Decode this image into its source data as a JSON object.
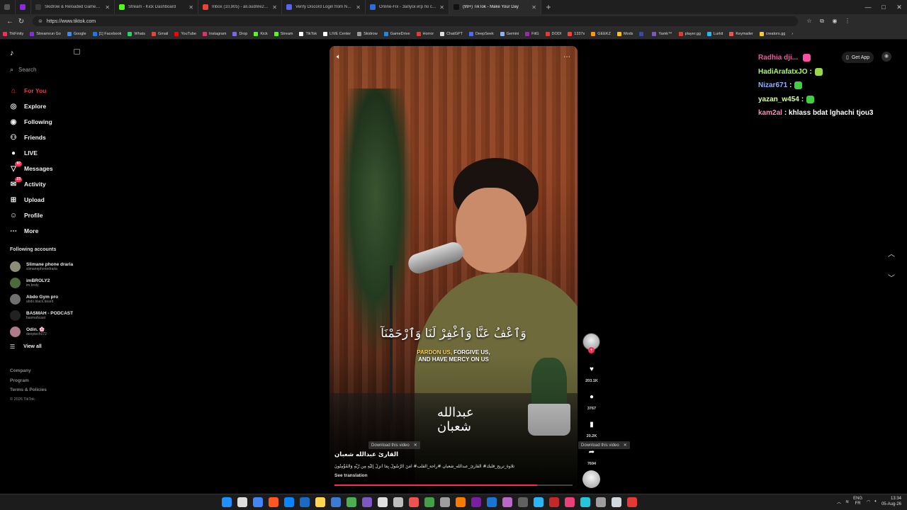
{
  "browser": {
    "tabs": [
      {
        "label": "",
        "color": "#555555"
      },
      {
        "label": "",
        "color": "#8a2be2"
      },
      {
        "label": "Skidrow & Reloaded Games – Do",
        "color": "#3a3a3a"
      },
      {
        "label": "Stream - Kick Dashboard",
        "color": "#53fc18"
      },
      {
        "label": "Inbox (10,905) - ali.oudrire263@",
        "color": "#ea4335"
      },
      {
        "label": "Verify Discord Login from New Lo",
        "color": "#5865f2"
      },
      {
        "label": "Online-Fix - Запуск игр по сети",
        "color": "#2d6cdf"
      },
      {
        "label": "(99+) TikTok - Make Your Day",
        "color": "#111111"
      }
    ],
    "url": "https://www.tiktok.com",
    "window_controls": [
      "—",
      "□",
      "✕"
    ],
    "bookmarks": [
      {
        "label": "TikFinity",
        "color": "#fe2c55"
      },
      {
        "label": "Streamrun Go",
        "color": "#8a2be2"
      },
      {
        "label": "Google",
        "color": "#4285f4"
      },
      {
        "label": "[1] Facebook",
        "color": "#1877f2"
      },
      {
        "label": "Whats",
        "color": "#25d366"
      },
      {
        "label": "Gmail",
        "color": "#ea4335"
      },
      {
        "label": "YouTube",
        "color": "#ff0000"
      },
      {
        "label": "Instagram",
        "color": "#e1306c"
      },
      {
        "label": "Drop",
        "color": "#7b68ee"
      },
      {
        "label": "Kick",
        "color": "#53fc18"
      },
      {
        "label": "Stream",
        "color": "#53fc18"
      },
      {
        "label": "TikTok",
        "color": "#ffffff"
      },
      {
        "label": "LIVE Center",
        "color": "#ffffff"
      },
      {
        "label": "Skidrow",
        "color": "#999999"
      },
      {
        "label": "GameDrive",
        "color": "#1e88e5"
      },
      {
        "label": "Horror",
        "color": "#e53935"
      },
      {
        "label": "ChatGPT",
        "color": "#dddddd"
      },
      {
        "label": "DeepSeek",
        "color": "#4d6bfe"
      },
      {
        "label": "Gemini",
        "color": "#8ab4f8"
      },
      {
        "label": "FitG",
        "color": "#9c27b0"
      },
      {
        "label": "DODI",
        "color": "#e53935"
      },
      {
        "label": "1337x",
        "color": "#f44336"
      },
      {
        "label": "GEEKZ",
        "color": "#ff9800"
      },
      {
        "label": "Mods",
        "color": "#ffc107"
      },
      {
        "label": "",
        "color": "#3949ab"
      },
      {
        "label": "Yamk™",
        "color": "#7e57c2"
      },
      {
        "label": "player.gg",
        "color": "#e53935"
      },
      {
        "label": "Lurkit",
        "color": "#29b6f6"
      },
      {
        "label": "Keymailer",
        "color": "#ef5350"
      },
      {
        "label": "creators.gg",
        "color": "#ffca28"
      }
    ]
  },
  "sidebar": {
    "search_placeholder": "Search",
    "nav": [
      {
        "label": "For You",
        "icon": "home-icon",
        "active": true
      },
      {
        "label": "Explore",
        "icon": "compass-icon"
      },
      {
        "label": "Following",
        "icon": "following-icon"
      },
      {
        "label": "Friends",
        "icon": "friends-icon"
      },
      {
        "label": "LIVE",
        "icon": "live-icon"
      },
      {
        "label": "Messages",
        "icon": "messages-icon",
        "badge": "92"
      },
      {
        "label": "Activity",
        "icon": "activity-icon",
        "badge": "23"
      },
      {
        "label": "Upload",
        "icon": "upload-icon"
      },
      {
        "label": "Profile",
        "icon": "profile-icon"
      },
      {
        "label": "More",
        "icon": "more-icon"
      }
    ],
    "following_title": "Following accounts",
    "accounts": [
      {
        "name": "Slimane phone draria",
        "handle": "slimanephonedraria",
        "color": "#8d8d7a"
      },
      {
        "name": "imBROLY2",
        "handle": "im.broly",
        "color": "#4c6b3a"
      },
      {
        "name": "Abdo Gym pro",
        "handle": "abdo.black.beard",
        "color": "#6f6f6f"
      },
      {
        "name": "BASMAH - PODCAST",
        "handle": "basmahcast",
        "color": "#222222"
      },
      {
        "name": "Odin. 🌸",
        "handle": "deeptech072",
        "color": "#b07a8a"
      }
    ],
    "view_all": "View all",
    "footer": [
      "Company",
      "Program",
      "Terms & Policies"
    ],
    "copyright": "© 2026 TikTok"
  },
  "video": {
    "subtitle_ar": "وَٱعْفُ عَنَّا وَٱغْفِرْ لَنَا وَٱرْحَمْنَآ",
    "subtitle_en_hl": "PARDON US,",
    "subtitle_en_rest": "FORGIVE US,",
    "subtitle_en_line2": "AND HAVE MERCY ON US",
    "signature": "عبدالله شعبان",
    "download_label": "Download this video",
    "author": "القارئ عبدالله شعبان",
    "caption": "تلاوة_تريح_قلبك# القارئ_عبدالله_شعبان #راحة_القلب# آمَنَ الرَّسُولُ بِمَا أُنزِلَ إِلَيْهِ مِن رَّبِّهِ وَالْمُؤْمِنُونَ",
    "see_translation": "See translation",
    "progress": 0.85
  },
  "actions": {
    "likes": "203.1K",
    "comments": "3767",
    "saves": "20.2K",
    "shares": "7694"
  },
  "topbar": {
    "get_app": "Get App"
  },
  "chat": [
    {
      "user": "Radhia dji...",
      "color": "#ff4fa3",
      "msg": ""
    },
    {
      "user": "HadiArafatxJO",
      "color": "#a6ff4d",
      "msg": ":"
    },
    {
      "user": "Nizar671",
      "color": "#8ab4ff",
      "msg": ":"
    },
    {
      "user": "yazan_w454",
      "color": "#d6ff9e",
      "msg": ":"
    },
    {
      "user": "kam2al",
      "color": "#ff8fb5",
      "msg": ": khlass bdat lghachi tjou3"
    }
  ],
  "taskbar": {
    "lang_top": "ENG",
    "lang_bottom": "FR",
    "time": "13:34",
    "date": "05-Aug-26"
  }
}
